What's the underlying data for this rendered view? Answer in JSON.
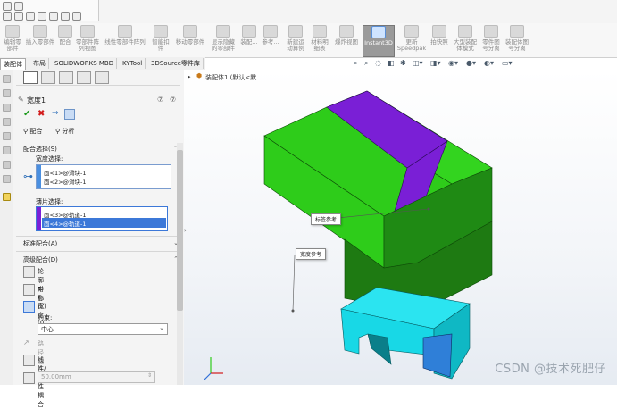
{
  "ribbon": {
    "buttons": [
      {
        "label": "编辑零\n部件",
        "active": false
      },
      {
        "label": "插入零部件",
        "active": false
      },
      {
        "label": "配合",
        "active": false
      },
      {
        "label": "零部件阵\n列视图",
        "active": false
      },
      {
        "label": "线性零部件阵列",
        "active": false
      },
      {
        "label": "智能扣\n件",
        "active": false
      },
      {
        "label": "移动零部件",
        "active": false
      },
      {
        "label": "显示隐藏\n的零部件",
        "active": false
      },
      {
        "label": "装配...",
        "active": false
      },
      {
        "label": "参考...",
        "active": false
      },
      {
        "label": "新建运\n动算例",
        "active": false
      },
      {
        "label": "材料明\n细表",
        "active": false
      },
      {
        "label": "爆炸视图",
        "active": false
      },
      {
        "label": "Instant3D",
        "active": true
      },
      {
        "label": "更新\nSpeedpak",
        "active": false
      },
      {
        "label": "拍快照",
        "active": false
      },
      {
        "label": "大型装配\n体模式",
        "active": false
      },
      {
        "label": "零件图\n号分离",
        "active": false
      },
      {
        "label": "装配体图\n号分离",
        "active": false
      }
    ]
  },
  "tabs": [
    {
      "label": "装配体",
      "active": true
    },
    {
      "label": "布局",
      "active": false
    },
    {
      "label": "SOLIDWORKS MBD",
      "active": false
    },
    {
      "label": "KYTool",
      "active": false
    },
    {
      "label": "3DSource零件库",
      "active": false
    }
  ],
  "tree": {
    "path": "装配体1  (默认<默..."
  },
  "panel": {
    "title": "宽度1",
    "sub_tabs": [
      "配合",
      "分析"
    ],
    "mate_selection_header": "配合选择(S)",
    "width_selection_label": "宽度选择:",
    "width_items": [
      "面<1>@滑块-1",
      "面<2>@滑块-1"
    ],
    "tab_selection_label": "薄片选择:",
    "tab_items": [
      "面<3>@轨道-1",
      "面<4>@轨道-1"
    ],
    "standard_header": "标准配合(A)",
    "advanced_header": "高级配合(D)",
    "advanced_items": [
      {
        "label": "轮廓中心",
        "icon": "profile-center-icon"
      },
      {
        "label": "对称(Y)",
        "icon": "symmetric-icon"
      },
      {
        "label": "宽度(I)",
        "icon": "width-icon"
      }
    ],
    "constraint_label": "约束:",
    "constraint_value": "中心",
    "path_mate": "路径配合(P)",
    "linear_coupler": "线性/线性耦合",
    "distance_value": "50.00mm"
  },
  "callouts": {
    "tab_ref": "标签参考",
    "width_ref": "宽度参考"
  },
  "watermark": "CSDN @技术死肥仔",
  "colors": {
    "green": "#2ecc1a",
    "dark_green": "#1f8a14",
    "purple": "#7a1fd6",
    "cyan": "#18d8e6",
    "blue": "#2f7fd8",
    "selection": "#3c78d8"
  }
}
